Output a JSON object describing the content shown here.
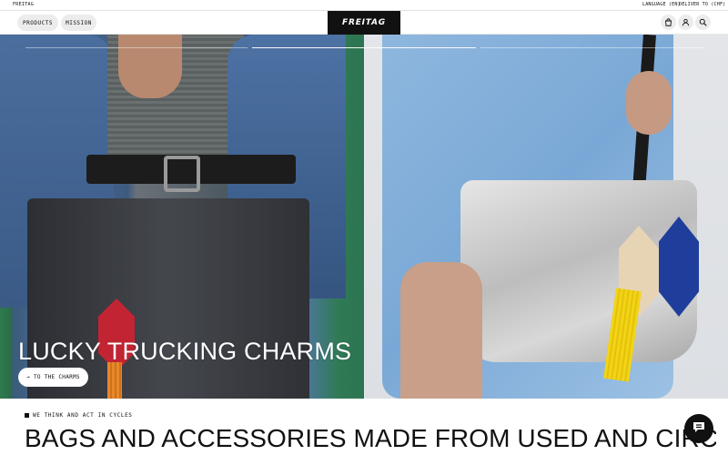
{
  "topbar": {
    "brand": "FREITAG",
    "language": "LANGUAGE (EN)",
    "deliver": "DELIVER TO (CHF)"
  },
  "header": {
    "nav": [
      {
        "label": "PRODUCTS"
      },
      {
        "label": "MISSION"
      }
    ],
    "logo": "FREITAG",
    "icons": [
      "bag-icon",
      "account-icon",
      "search-icon"
    ]
  },
  "hero": {
    "slide_progress": {
      "total": 3,
      "active": 2
    },
    "title": "LUCKY TRUCKING CHARMS",
    "cta": "→ TO THE CHARMS"
  },
  "section": {
    "eyebrow": "WE THINK AND ACT IN CYCLES",
    "headline": "BAGS AND ACCESSORIES MADE FROM USED AND CIRCULAR MATERIALS"
  },
  "chat": {
    "icon": "chat-icon"
  },
  "colors": {
    "accent": "#111111",
    "pill_bg": "#ececec"
  }
}
